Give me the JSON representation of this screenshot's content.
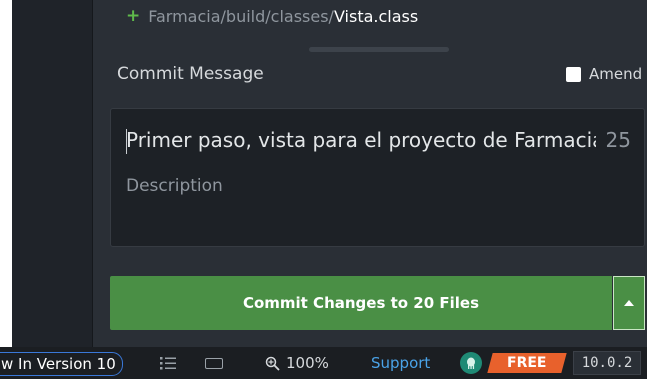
{
  "changes": {
    "file_prefix": "Farmacia/build/classes/",
    "file_name": "Vista.class",
    "status_symbol": "+"
  },
  "commit": {
    "section_label": "Commit Message",
    "amend_label": "Amend",
    "amend_checked": false,
    "summary_value": "Primer paso, vista para el proyecto de Farmacia",
    "char_count": "25",
    "description_placeholder": "Description",
    "button_label": "Commit Changes to 20 Files"
  },
  "statusbar": {
    "version_pill": "w In Version 10",
    "zoom": "100%",
    "support": "Support",
    "plan": "FREE",
    "version": "10.0.2"
  },
  "colors": {
    "accent_green": "#4a8f45",
    "plus_green": "#5fba4b",
    "link_blue": "#4aa3e8",
    "free_orange": "#e8612c"
  }
}
